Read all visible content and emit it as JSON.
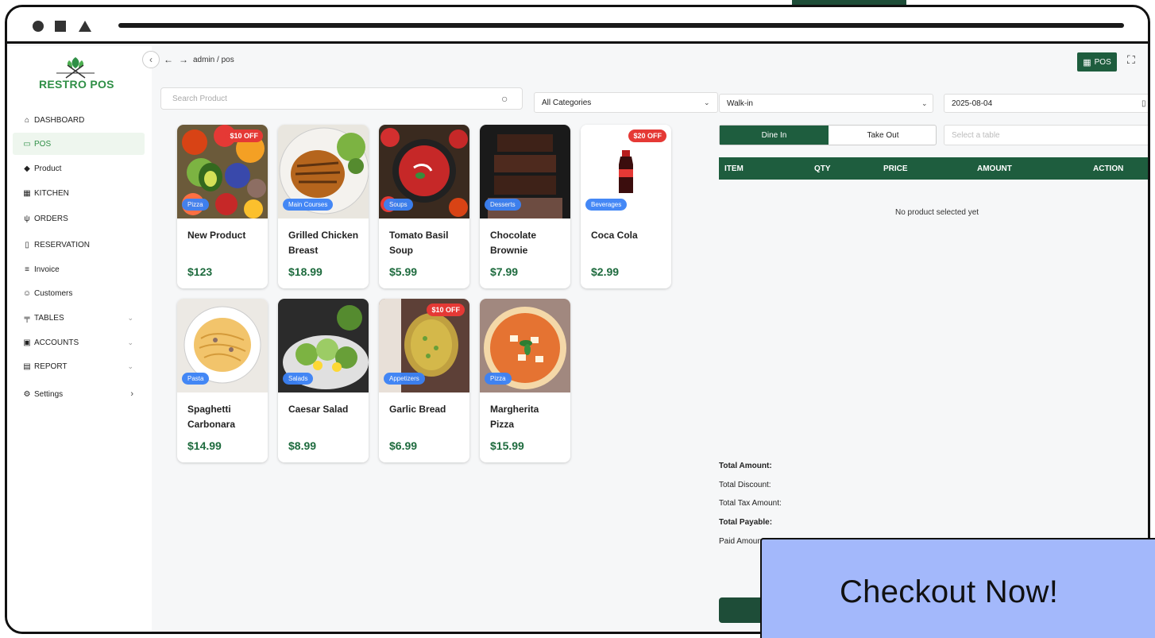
{
  "colors": {
    "brand": "#2f8f46",
    "dark_green": "#1e5d3e",
    "badge_red": "#e53935",
    "badge_blue": "#3b82f6",
    "cta_bg": "#a3b8fb"
  },
  "app": {
    "logo_text": "RESTRO POS"
  },
  "sidebar": {
    "items": [
      {
        "label": "DASHBOARD",
        "icon": "home-icon"
      },
      {
        "label": "POS",
        "icon": "monitor-icon"
      },
      {
        "label": "Product",
        "icon": "tag-icon"
      },
      {
        "label": "KITCHEN",
        "icon": "kitchen-icon"
      },
      {
        "label": "ORDERS",
        "icon": "utensils-icon"
      },
      {
        "label": "RESERVATION",
        "icon": "book-icon"
      },
      {
        "label": "Invoice",
        "icon": "list-icon"
      },
      {
        "label": "Customers",
        "icon": "user-icon"
      },
      {
        "label": "TABLES",
        "icon": "table-icon"
      },
      {
        "label": "ACCOUNTS",
        "icon": "ledger-icon"
      },
      {
        "label": "REPORT",
        "icon": "report-icon"
      },
      {
        "label": "Settings",
        "icon": "gear-icon"
      }
    ]
  },
  "breadcrumb": "admin / pos",
  "header": {
    "pos_label": "POS"
  },
  "search": {
    "placeholder": "Search Product"
  },
  "filters": {
    "category": "All Categories"
  },
  "products": [
    {
      "name": "New Product",
      "price": "$123",
      "category": "Pizza",
      "discount": "$10 OFF"
    },
    {
      "name": "Grilled Chicken Breast",
      "price": "$18.99",
      "category": "Main Courses",
      "discount": ""
    },
    {
      "name": "Tomato Basil Soup",
      "price": "$5.99",
      "category": "Soups",
      "discount": ""
    },
    {
      "name": "Chocolate Brownie",
      "price": "$7.99",
      "category": "Desserts",
      "discount": ""
    },
    {
      "name": "Coca Cola",
      "price": "$2.99",
      "category": "Beverages",
      "discount": "$20 OFF"
    },
    {
      "name": "Spaghetti Carbonara",
      "price": "$14.99",
      "category": "Pasta",
      "discount": ""
    },
    {
      "name": "Caesar Salad",
      "price": "$8.99",
      "category": "Salads",
      "discount": ""
    },
    {
      "name": "Garlic Bread",
      "price": "$6.99",
      "category": "Appetizers",
      "discount": "$10 OFF"
    },
    {
      "name": "Margherita Pizza",
      "price": "$15.99",
      "category": "Pizza",
      "discount": ""
    }
  ],
  "cart": {
    "customer": "Walk-in",
    "date": "2025-08-04",
    "order_types": [
      "Dine In",
      "Take Out"
    ],
    "table_placeholder": "Select a table",
    "columns": [
      "ITEM",
      "QTY",
      "PRICE",
      "AMOUNT",
      "ACTION"
    ],
    "empty_text": "No product selected yet",
    "totals": {
      "total_amount": "Total Amount:",
      "total_discount": "Total Discount:",
      "total_tax": "Total Tax Amount:",
      "total_payable": "Total Payable:",
      "paid_amount": "Paid Amount:"
    }
  },
  "cta": {
    "label": "Checkout Now!"
  }
}
